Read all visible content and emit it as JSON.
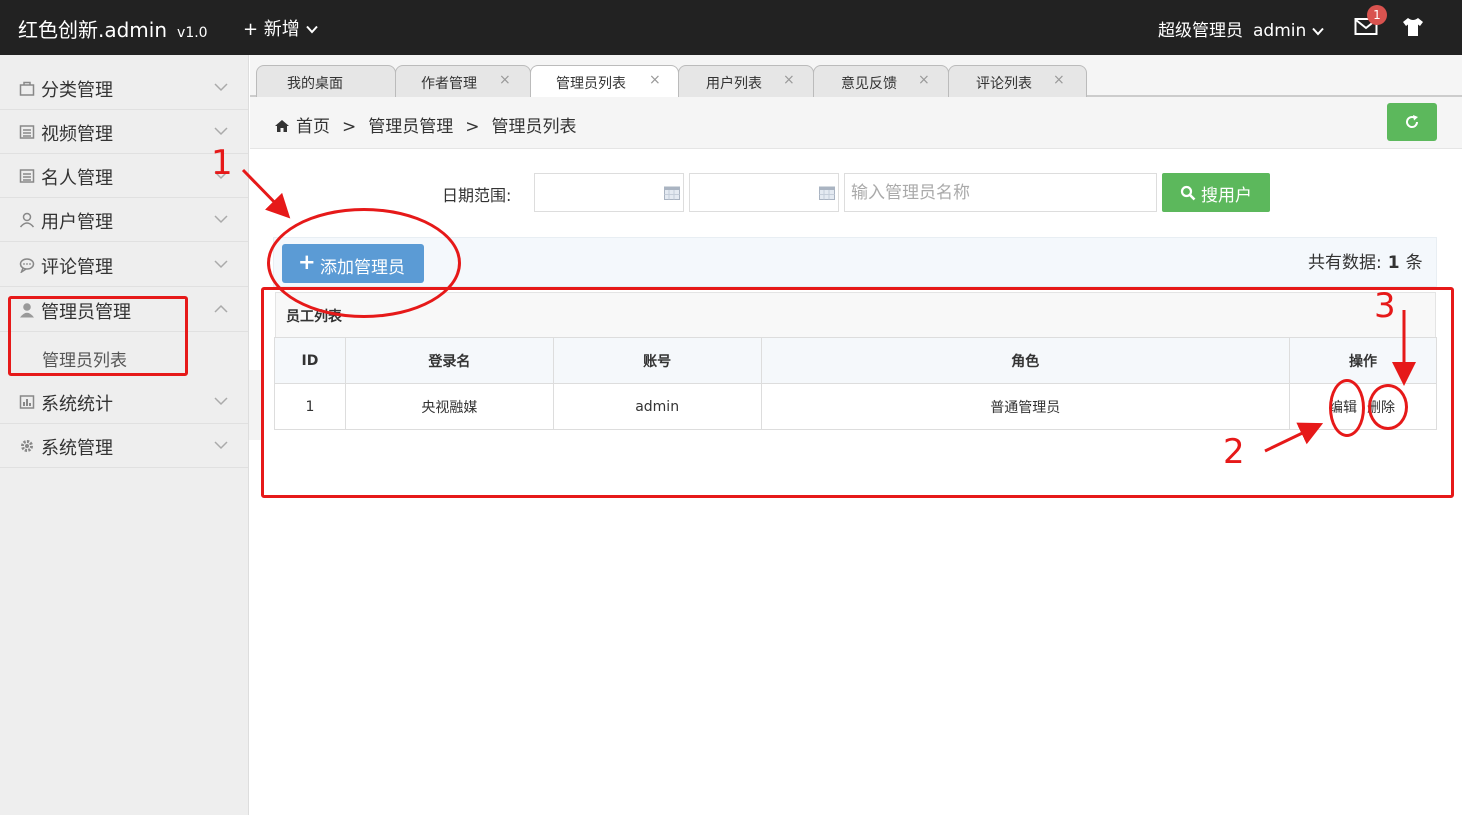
{
  "header": {
    "brand": "红色创新.admin",
    "version": "v1.0",
    "new_label": "+ 新增",
    "role": "超级管理员",
    "username": "admin",
    "mail_badge": "1"
  },
  "sidebar": {
    "items": [
      {
        "label": "分类管理"
      },
      {
        "label": "视频管理"
      },
      {
        "label": "名人管理"
      },
      {
        "label": "用户管理"
      },
      {
        "label": "评论管理"
      },
      {
        "label": "管理员管理"
      },
      {
        "label": "系统统计"
      },
      {
        "label": "系统管理"
      }
    ],
    "sub_item": "管理员列表"
  },
  "tabs": [
    {
      "label": "我的桌面"
    },
    {
      "label": "作者管理"
    },
    {
      "label": "管理员列表"
    },
    {
      "label": "用户列表"
    },
    {
      "label": "意见反馈"
    },
    {
      "label": "评论列表"
    }
  ],
  "breadcrumb": {
    "home": "首页",
    "level1": "管理员管理",
    "level2": "管理员列表",
    "separator": ">"
  },
  "search": {
    "date_label": "日期范围:",
    "name_placeholder": "输入管理员名称",
    "button_label": "搜用户"
  },
  "toolbar": {
    "add_label": "添加管理员",
    "total_prefix": "共有数据:",
    "total_count": "1",
    "total_suffix": "条"
  },
  "table": {
    "title": "员工列表",
    "columns": [
      "ID",
      "登录名",
      "账号",
      "角色",
      "操作"
    ],
    "rows": [
      {
        "id": "1",
        "login": "央视融媒",
        "account": "admin",
        "role": "普通管理员",
        "edit": "编辑",
        "delete": "删除"
      }
    ]
  },
  "annotations": {
    "num1": "1",
    "num2": "2",
    "num3": "3",
    "color": "#e61919"
  },
  "colors": {
    "header_bg": "#222222",
    "green": "#5cb85c",
    "blue": "#5b9bd5",
    "badge": "#d9534f"
  }
}
